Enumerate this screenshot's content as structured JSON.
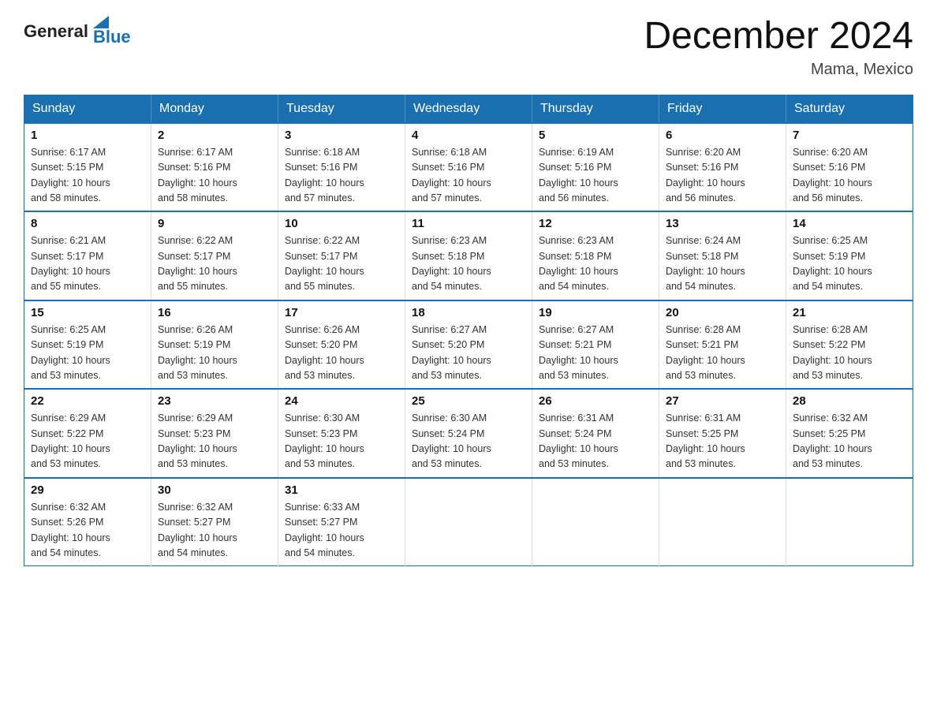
{
  "logo": {
    "general": "General",
    "blue": "Blue"
  },
  "title": "December 2024",
  "location": "Mama, Mexico",
  "days_of_week": [
    "Sunday",
    "Monday",
    "Tuesday",
    "Wednesday",
    "Thursday",
    "Friday",
    "Saturday"
  ],
  "weeks": [
    [
      {
        "day": "1",
        "sunrise": "6:17 AM",
        "sunset": "5:15 PM",
        "daylight": "10 hours and 58 minutes."
      },
      {
        "day": "2",
        "sunrise": "6:17 AM",
        "sunset": "5:16 PM",
        "daylight": "10 hours and 58 minutes."
      },
      {
        "day": "3",
        "sunrise": "6:18 AM",
        "sunset": "5:16 PM",
        "daylight": "10 hours and 57 minutes."
      },
      {
        "day": "4",
        "sunrise": "6:18 AM",
        "sunset": "5:16 PM",
        "daylight": "10 hours and 57 minutes."
      },
      {
        "day": "5",
        "sunrise": "6:19 AM",
        "sunset": "5:16 PM",
        "daylight": "10 hours and 56 minutes."
      },
      {
        "day": "6",
        "sunrise": "6:20 AM",
        "sunset": "5:16 PM",
        "daylight": "10 hours and 56 minutes."
      },
      {
        "day": "7",
        "sunrise": "6:20 AM",
        "sunset": "5:16 PM",
        "daylight": "10 hours and 56 minutes."
      }
    ],
    [
      {
        "day": "8",
        "sunrise": "6:21 AM",
        "sunset": "5:17 PM",
        "daylight": "10 hours and 55 minutes."
      },
      {
        "day": "9",
        "sunrise": "6:22 AM",
        "sunset": "5:17 PM",
        "daylight": "10 hours and 55 minutes."
      },
      {
        "day": "10",
        "sunrise": "6:22 AM",
        "sunset": "5:17 PM",
        "daylight": "10 hours and 55 minutes."
      },
      {
        "day": "11",
        "sunrise": "6:23 AM",
        "sunset": "5:18 PM",
        "daylight": "10 hours and 54 minutes."
      },
      {
        "day": "12",
        "sunrise": "6:23 AM",
        "sunset": "5:18 PM",
        "daylight": "10 hours and 54 minutes."
      },
      {
        "day": "13",
        "sunrise": "6:24 AM",
        "sunset": "5:18 PM",
        "daylight": "10 hours and 54 minutes."
      },
      {
        "day": "14",
        "sunrise": "6:25 AM",
        "sunset": "5:19 PM",
        "daylight": "10 hours and 54 minutes."
      }
    ],
    [
      {
        "day": "15",
        "sunrise": "6:25 AM",
        "sunset": "5:19 PM",
        "daylight": "10 hours and 53 minutes."
      },
      {
        "day": "16",
        "sunrise": "6:26 AM",
        "sunset": "5:19 PM",
        "daylight": "10 hours and 53 minutes."
      },
      {
        "day": "17",
        "sunrise": "6:26 AM",
        "sunset": "5:20 PM",
        "daylight": "10 hours and 53 minutes."
      },
      {
        "day": "18",
        "sunrise": "6:27 AM",
        "sunset": "5:20 PM",
        "daylight": "10 hours and 53 minutes."
      },
      {
        "day": "19",
        "sunrise": "6:27 AM",
        "sunset": "5:21 PM",
        "daylight": "10 hours and 53 minutes."
      },
      {
        "day": "20",
        "sunrise": "6:28 AM",
        "sunset": "5:21 PM",
        "daylight": "10 hours and 53 minutes."
      },
      {
        "day": "21",
        "sunrise": "6:28 AM",
        "sunset": "5:22 PM",
        "daylight": "10 hours and 53 minutes."
      }
    ],
    [
      {
        "day": "22",
        "sunrise": "6:29 AM",
        "sunset": "5:22 PM",
        "daylight": "10 hours and 53 minutes."
      },
      {
        "day": "23",
        "sunrise": "6:29 AM",
        "sunset": "5:23 PM",
        "daylight": "10 hours and 53 minutes."
      },
      {
        "day": "24",
        "sunrise": "6:30 AM",
        "sunset": "5:23 PM",
        "daylight": "10 hours and 53 minutes."
      },
      {
        "day": "25",
        "sunrise": "6:30 AM",
        "sunset": "5:24 PM",
        "daylight": "10 hours and 53 minutes."
      },
      {
        "day": "26",
        "sunrise": "6:31 AM",
        "sunset": "5:24 PM",
        "daylight": "10 hours and 53 minutes."
      },
      {
        "day": "27",
        "sunrise": "6:31 AM",
        "sunset": "5:25 PM",
        "daylight": "10 hours and 53 minutes."
      },
      {
        "day": "28",
        "sunrise": "6:32 AM",
        "sunset": "5:25 PM",
        "daylight": "10 hours and 53 minutes."
      }
    ],
    [
      {
        "day": "29",
        "sunrise": "6:32 AM",
        "sunset": "5:26 PM",
        "daylight": "10 hours and 54 minutes."
      },
      {
        "day": "30",
        "sunrise": "6:32 AM",
        "sunset": "5:27 PM",
        "daylight": "10 hours and 54 minutes."
      },
      {
        "day": "31",
        "sunrise": "6:33 AM",
        "sunset": "5:27 PM",
        "daylight": "10 hours and 54 minutes."
      },
      null,
      null,
      null,
      null
    ]
  ],
  "labels": {
    "sunrise": "Sunrise:",
    "sunset": "Sunset:",
    "daylight": "Daylight:"
  }
}
